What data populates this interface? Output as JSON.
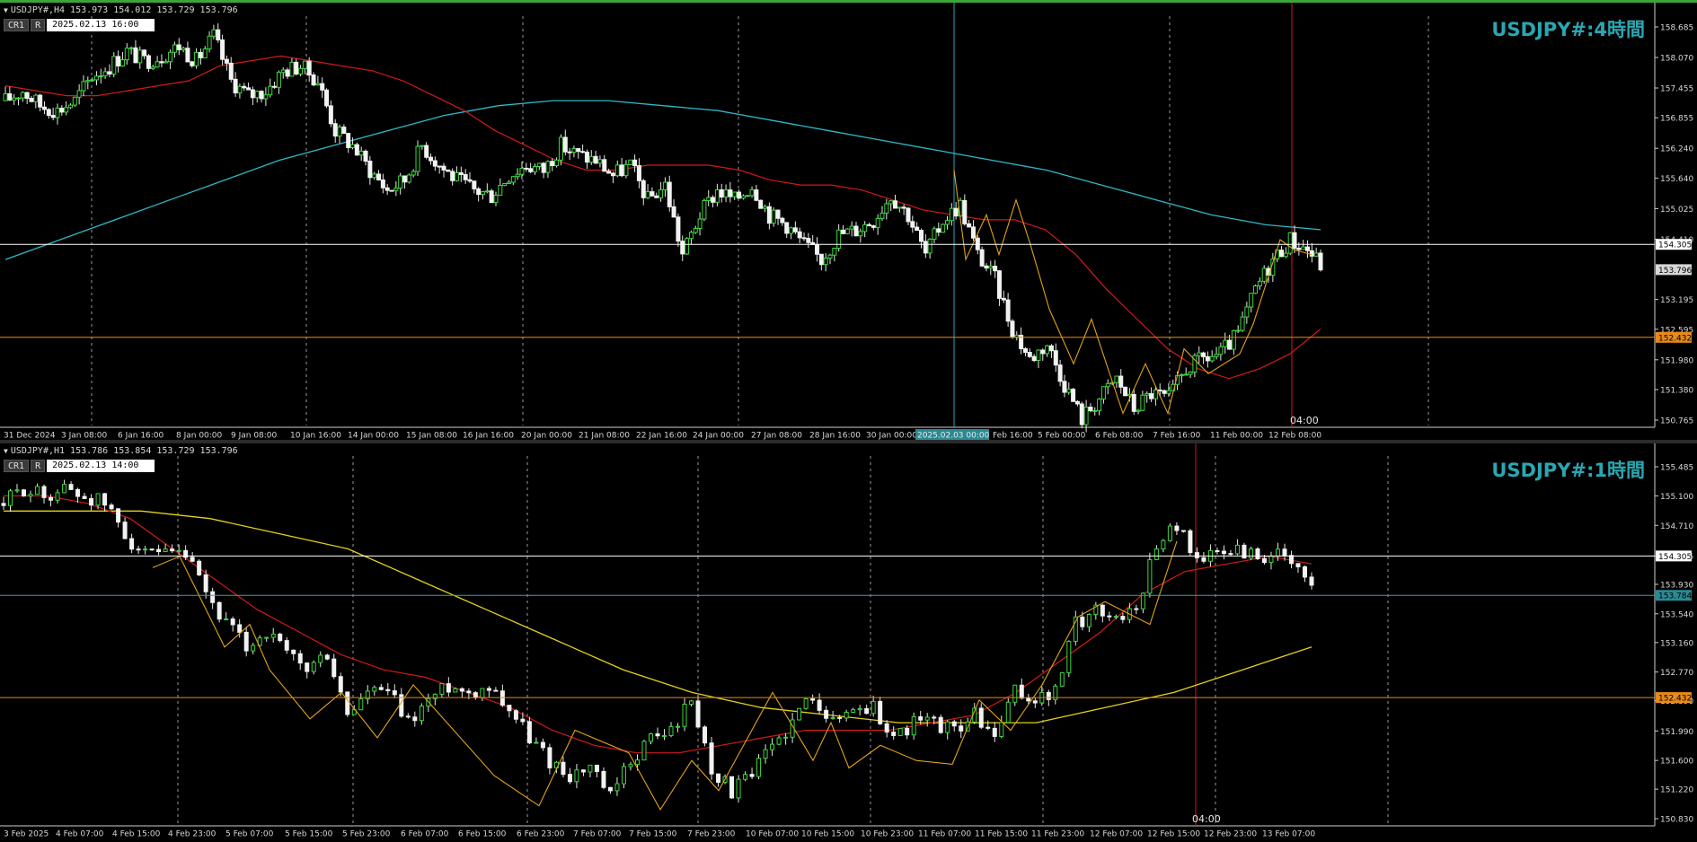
{
  "h4": {
    "header": "USDJPY#,H4  153.973 154.012 153.729 153.796",
    "cr_label": "CR1",
    "r_label": "R",
    "datetime": "2025.02.13 16:00",
    "title": "USDJPY#:4時間",
    "time_marker": "04:00",
    "price_ticks": [
      "158.685",
      "158.070",
      "157.455",
      "156.855",
      "156.240",
      "155.640",
      "155.025",
      "154.410",
      "153.195",
      "152.595",
      "151.980",
      "151.380",
      "150.765"
    ],
    "badges": {
      "line_white": "154.305",
      "current": "153.796",
      "line_orange": "152.432"
    },
    "time_labels": [
      "31 Dec 2024",
      "3 Jan 08:00",
      "6 Jan 16:00",
      "8 Jan 00:00",
      "9 Jan 08:00",
      "10 Jan 16:00",
      "14 Jan 00:00",
      "15 Jan 08:00",
      "16 Jan 16:00",
      "20 Jan 00:00",
      "21 Jan 08:00",
      "22 Jan 16:00",
      "24 Jan 00:00",
      "27 Jan 08:00",
      "28 Jan 16:00",
      "30 Jan 00:00",
      "2025.02.03 00:00",
      "Feb 16:00",
      "5 Feb 00:00",
      "6 Feb 08:00",
      "7 Feb 16:00",
      "11 Feb 00:00",
      "12 Feb 08:00"
    ],
    "colors": {
      "ma_fast": "#d11a1a",
      "ma_slow": "#2fb8c8",
      "line_white": "#ffffff",
      "line_orange": "#e88a17",
      "cursor_v": "#2aa7b3",
      "marker_v": "#d11a1a",
      "zigzag": "#e0a21a"
    }
  },
  "h1": {
    "header": "USDJPY#,H1  153.786 153.854 153.729 153.796",
    "cr_label": "CR1",
    "r_label": "R",
    "datetime": "2025.02.13 14:00",
    "title": "USDJPY#:1時間",
    "time_marker": "04:00",
    "price_ticks": [
      "155.485",
      "155.100",
      "154.710",
      "154.305",
      "153.930",
      "153.540",
      "153.160",
      "152.770",
      "152.390",
      "151.990",
      "151.600",
      "151.220",
      "150.830"
    ],
    "badges": {
      "line_white": "154.305",
      "current": "153.784",
      "line_orange": "152.432"
    },
    "time_labels": [
      "3 Feb 2025",
      "4 Feb 07:00",
      "4 Feb 15:00",
      "4 Feb 23:00",
      "5 Feb 07:00",
      "5 Feb 15:00",
      "5 Feb 23:00",
      "6 Feb 07:00",
      "6 Feb 15:00",
      "6 Feb 23:00",
      "7 Feb 07:00",
      "7 Feb 15:00",
      "7 Feb 23:00",
      "10 Feb 07:00",
      "10 Feb 15:00",
      "10 Feb 23:00",
      "11 Feb 07:00",
      "11 Feb 15:00",
      "11 Feb 23:00",
      "12 Feb 07:00",
      "12 Feb 15:00",
      "12 Feb 23:00",
      "13 Feb 07:00"
    ],
    "colors": {
      "ma_fast": "#d11a1a",
      "ma_slow": "#e3d21a",
      "line_white": "#ffffff",
      "line_teal": "#2aa7b3",
      "line_orange": "#e88a17",
      "marker_v": "#d11a1a",
      "zigzag": "#e0a21a"
    }
  },
  "chart_data": [
    {
      "type": "candlestick",
      "symbol": "USDJPY#",
      "timeframe": "H4",
      "ylim": [
        150.765,
        158.685
      ],
      "ohlc_last": {
        "open": 153.973,
        "high": 154.012,
        "low": 153.729,
        "close": 153.796
      },
      "horizontal_lines": [
        154.305,
        152.432
      ],
      "current_price": 153.796,
      "price_path": [
        157.2,
        157.4,
        157.1,
        157.0,
        157.2,
        157.7,
        157.9,
        158.2,
        158.0,
        158.1,
        158.3,
        158.0,
        158.5,
        157.6,
        157.3,
        157.4,
        157.8,
        157.9,
        157.6,
        156.6,
        156.3,
        155.8,
        155.4,
        155.6,
        156.3,
        155.9,
        155.6,
        155.4,
        155.3,
        155.7,
        155.9,
        155.8,
        156.3,
        156.1,
        156.0,
        155.7,
        155.9,
        155.2,
        155.5,
        154.1,
        154.9,
        155.4,
        155.2,
        155.5,
        154.9,
        154.7,
        154.3,
        154.0,
        154.5,
        154.6,
        154.8,
        155.3,
        154.9,
        154.1,
        154.8,
        155.1,
        154.1,
        153.6,
        152.6,
        152.0,
        152.3,
        151.5,
        150.8,
        151.2,
        151.6,
        151.0,
        151.3,
        151.2,
        151.8,
        152.0,
        152.1,
        152.5,
        153.4,
        154.0,
        154.4,
        154.2,
        153.8
      ],
      "ma_fast": [
        157.5,
        157.4,
        157.3,
        157.3,
        157.4,
        157.5,
        157.6,
        157.9,
        158.0,
        158.1,
        158.0,
        157.9,
        157.8,
        157.6,
        157.3,
        157.0,
        156.6,
        156.3,
        156.0,
        155.8,
        155.8,
        155.9,
        155.9,
        155.9,
        155.8,
        155.6,
        155.5,
        155.5,
        155.4,
        155.2,
        155.0,
        154.9,
        154.8,
        154.8,
        154.6,
        154.1,
        153.4,
        152.8,
        152.2,
        151.8,
        151.6,
        151.8,
        152.1,
        152.6
      ],
      "ma_slow": [
        154.0,
        154.4,
        154.8,
        155.2,
        155.6,
        156.0,
        156.3,
        156.6,
        156.9,
        157.1,
        157.2,
        157.2,
        157.1,
        157.0,
        156.8,
        156.6,
        156.4,
        156.2,
        156.0,
        155.8,
        155.5,
        155.2,
        154.9,
        154.7,
        154.6
      ]
    },
    {
      "type": "candlestick",
      "symbol": "USDJPY#",
      "timeframe": "H1",
      "ylim": [
        150.83,
        155.485
      ],
      "ohlc_last": {
        "open": 153.786,
        "high": 153.854,
        "low": 153.729,
        "close": 153.796
      },
      "horizontal_lines": [
        154.305,
        153.784,
        152.432
      ],
      "current_price": 153.784,
      "price_path": [
        155.0,
        155.2,
        155.1,
        155.2,
        155.1,
        155.0,
        154.6,
        154.3,
        154.3,
        154.3,
        153.8,
        153.4,
        153.1,
        153.3,
        153.0,
        152.8,
        153.0,
        152.2,
        152.5,
        152.5,
        152.1,
        152.4,
        152.6,
        152.5,
        152.6,
        152.3,
        151.9,
        151.6,
        151.4,
        151.5,
        151.1,
        151.6,
        151.9,
        152.0,
        152.4,
        151.5,
        151.2,
        151.4,
        151.8,
        152.1,
        152.5,
        152.1,
        152.3,
        152.3,
        151.9,
        152.1,
        152.1,
        152.0,
        152.2,
        151.9,
        152.5,
        152.4,
        152.5,
        153.4,
        153.6,
        153.5,
        153.6,
        154.5,
        154.7,
        154.3,
        154.3,
        154.4,
        154.3,
        154.3,
        154.1,
        153.8
      ],
      "ma_fast": [
        155.1,
        155.1,
        155.0,
        154.8,
        154.4,
        154.0,
        153.6,
        153.3,
        153.0,
        152.8,
        152.7,
        152.5,
        152.3,
        152.0,
        151.8,
        151.7,
        151.7,
        151.8,
        151.9,
        152.0,
        152.0,
        152.0,
        152.1,
        152.2,
        152.5,
        152.9,
        153.3,
        153.8,
        154.1,
        154.2,
        154.3,
        154.2
      ],
      "ma_slow": [
        154.9,
        154.9,
        154.9,
        154.8,
        154.6,
        154.4,
        154.0,
        153.6,
        153.2,
        152.8,
        152.5,
        152.3,
        152.2,
        152.1,
        152.1,
        152.1,
        152.3,
        152.5,
        152.8,
        153.1
      ]
    }
  ]
}
